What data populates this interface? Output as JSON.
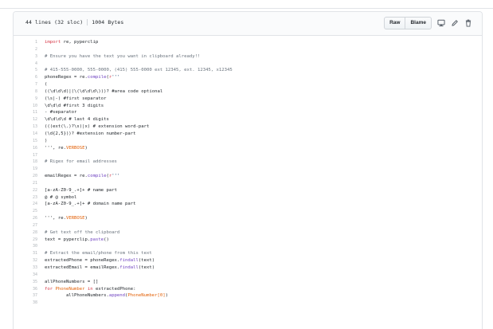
{
  "file_header": {
    "lines_info": "44 lines (32 sloc)",
    "size_info": "1004 Bytes",
    "raw_label": "Raw",
    "blame_label": "Blame",
    "icons": [
      "desktop-icon",
      "pencil-icon",
      "trash-icon"
    ]
  },
  "code_lines": [
    {
      "n": "1",
      "t": "import re, pyperclip"
    },
    {
      "n": "2",
      "t": ""
    },
    {
      "n": "3",
      "t": "# Ensure you have the text you want in clipboard already!!"
    },
    {
      "n": "4",
      "t": ""
    },
    {
      "n": "5",
      "t": "# 415-555-0000, 555-0000, (415) 555-0000 ext 12345, ext. 12345, x12345"
    },
    {
      "n": "6",
      "t": "phoneRegex = re.compile(r'''"
    },
    {
      "n": "7",
      "t": "("
    },
    {
      "n": "8",
      "t": "((\\d\\d\\d)|(\\(\\d\\d\\d\\)))? #area code optional"
    },
    {
      "n": "9",
      "t": "(\\s|-) #first separator"
    },
    {
      "n": "10",
      "t": "\\d\\d\\d #first 3 digits"
    },
    {
      "n": "11",
      "t": "- #separator"
    },
    {
      "n": "12",
      "t": "\\d\\d\\d\\d # last 4 digits"
    },
    {
      "n": "13",
      "t": "(((ext(\\.)?\\s)|x) # extension word-part"
    },
    {
      "n": "14",
      "t": "(\\d{2,5}))? #extension number-part"
    },
    {
      "n": "15",
      "t": ")"
    },
    {
      "n": "16",
      "t": "''', re.VERBOSE)"
    },
    {
      "n": "17",
      "t": ""
    },
    {
      "n": "18",
      "t": "# Rigex for email addresses"
    },
    {
      "n": "19",
      "t": ""
    },
    {
      "n": "20",
      "t": "emailRegex = re.compile(r'''"
    },
    {
      "n": "21",
      "t": ""
    },
    {
      "n": "22",
      "t": "[a-zA-Z0-9_.+]+ # name part"
    },
    {
      "n": "23",
      "t": "@ # @ symbol"
    },
    {
      "n": "24",
      "t": "[a-zA-Z0-9_.+]+ # domain name part"
    },
    {
      "n": "25",
      "t": ""
    },
    {
      "n": "26",
      "t": "''', re.VERBOSE)"
    },
    {
      "n": "27",
      "t": ""
    },
    {
      "n": "28",
      "t": "# Get text off the clipboard"
    },
    {
      "n": "29",
      "t": "text = pyperclip.paste()"
    },
    {
      "n": "30",
      "t": ""
    },
    {
      "n": "31",
      "t": "# Extract the email/phone from this text"
    },
    {
      "n": "32",
      "t": "extractedPhone = phoneRegex.findall(text)"
    },
    {
      "n": "33",
      "t": "extractedEmail = emailRegex.findall(text)"
    },
    {
      "n": "34",
      "t": ""
    },
    {
      "n": "35",
      "t": "allPhoneNumbers = []"
    },
    {
      "n": "36",
      "t": "for PhoneNumber in extractedPhone:"
    },
    {
      "n": "37",
      "t": "        allPhoneNumbers.append(PhoneNumber[0])"
    },
    {
      "n": "38",
      "t": ""
    }
  ],
  "colors": {
    "keyword": "#d73a49",
    "string": "#032f62",
    "comment": "#6a737d",
    "function": "#6f42c1",
    "variable": "#e36209",
    "line_number": "#b0b5ba"
  }
}
